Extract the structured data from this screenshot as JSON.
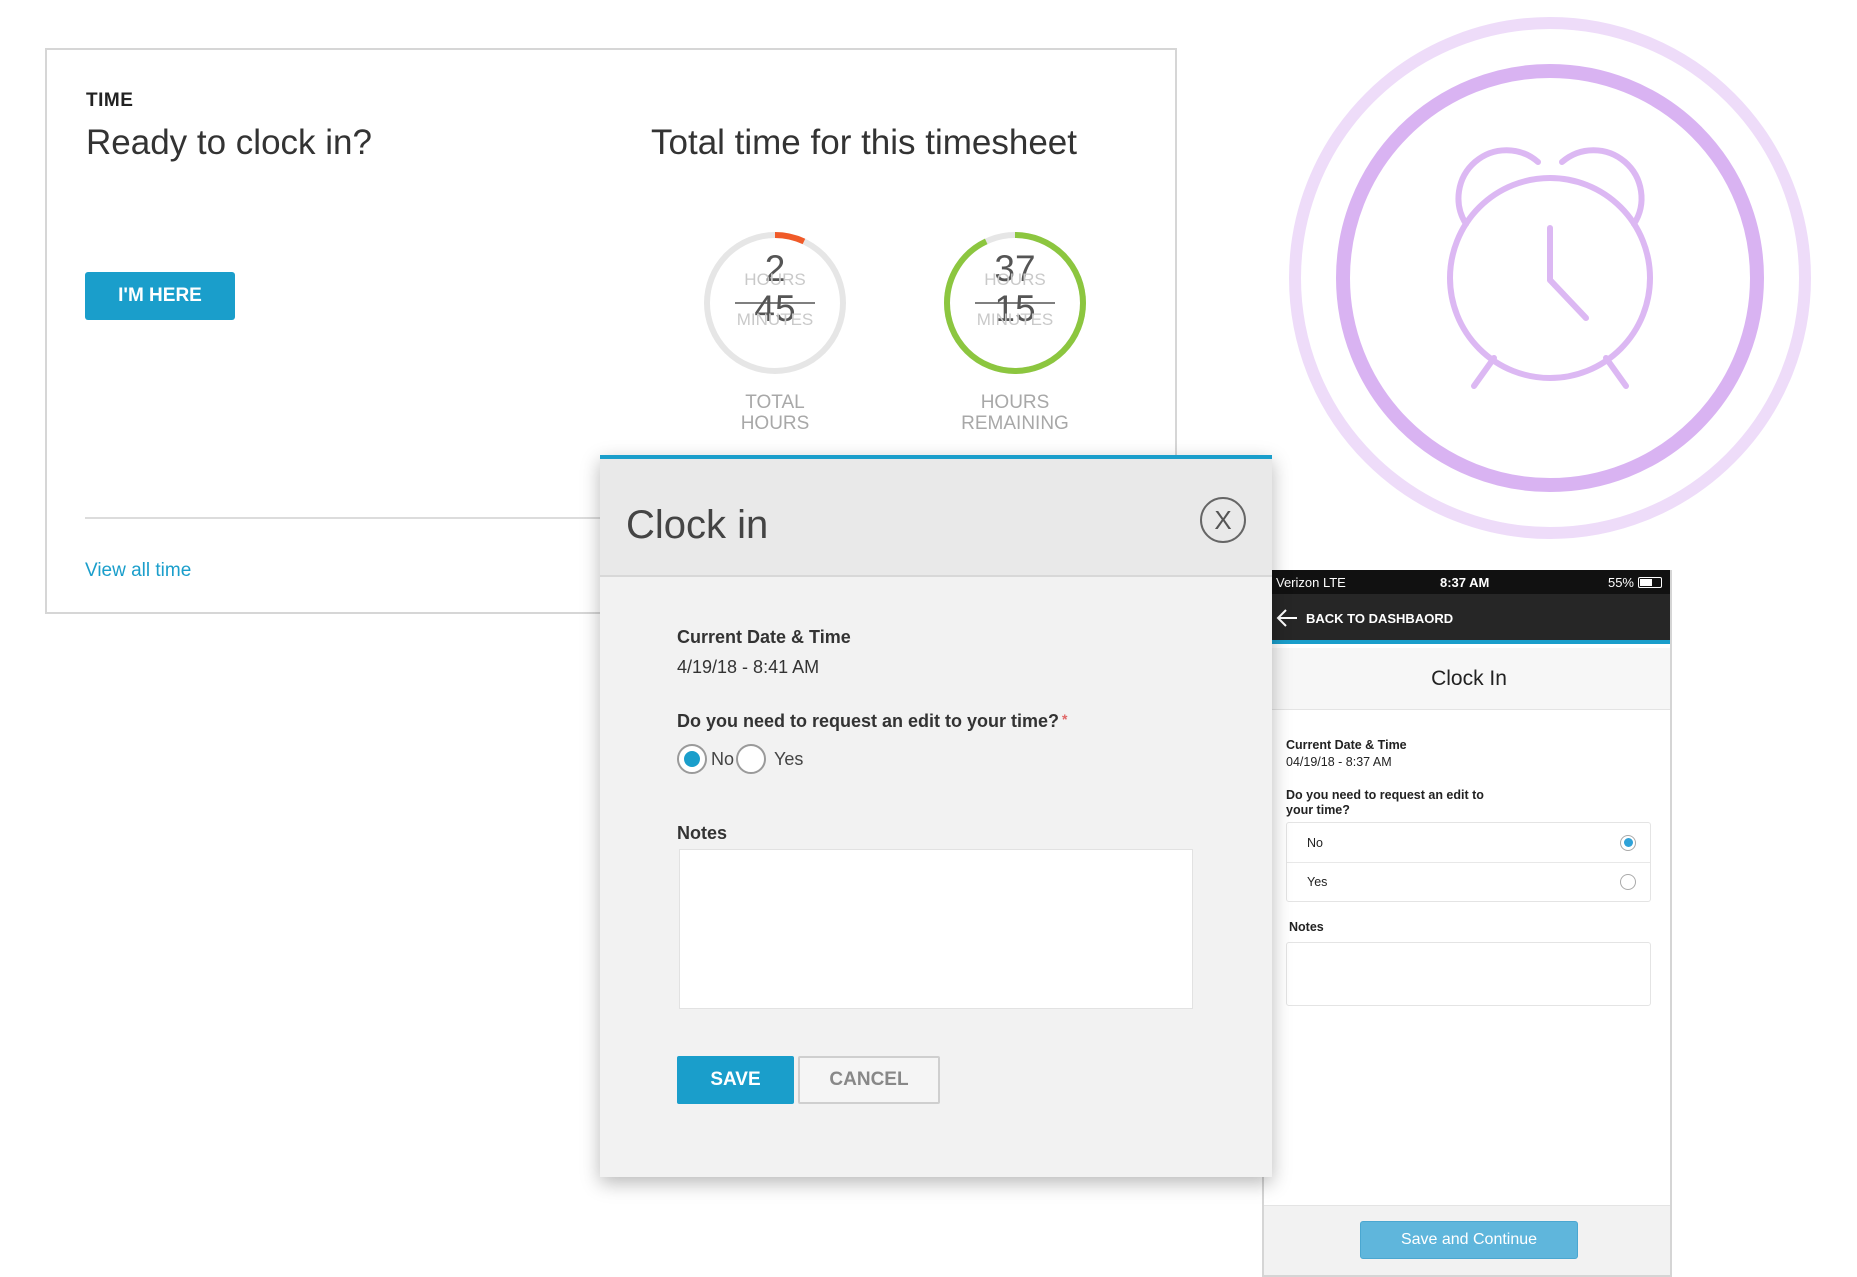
{
  "time_card": {
    "section_label": "TIME",
    "headline": "Ready to clock in?",
    "total_title": "Total time for this timesheet",
    "im_here_label": "I'M HERE",
    "view_all_label": "View all time",
    "total_hours": {
      "hours": "2",
      "hours_unit": "HOURS",
      "minutes": "45",
      "minutes_unit": "MINUTES",
      "caption_line1": "TOTAL",
      "caption_line2": "HOURS",
      "progress": 0.07,
      "color": "#f05a28"
    },
    "hours_remaining": {
      "hours": "37",
      "hours_unit": "HOURS",
      "minutes": "15",
      "minutes_unit": "MINUTES",
      "caption_line1": "HOURS",
      "caption_line2": "REMAINING",
      "progress": 0.93,
      "color": "#8cc63f"
    }
  },
  "illustration": {
    "icon": "alarm-clock-icon",
    "color": "#d4a8f0"
  },
  "modal": {
    "title": "Clock in",
    "close_label": "X",
    "datetime_label": "Current Date & Time",
    "datetime_value": "4/19/18 - 8:41 AM",
    "edit_question": "Do you need to request an edit to your time?",
    "required_marker": "*",
    "options": [
      "No",
      "Yes"
    ],
    "selected_option": "No",
    "notes_label": "Notes",
    "notes_value": "",
    "save_label": "SAVE",
    "cancel_label": "CANCEL"
  },
  "mobile": {
    "carrier": "Verizon  LTE",
    "time": "8:37 AM",
    "battery": "55%",
    "battery_level": 0.55,
    "back_label": "BACK TO DASHBAORD",
    "title": "Clock In",
    "datetime_label": "Current Date & Time",
    "datetime_value": "04/19/18 - 8:37 AM",
    "edit_question_line1": "Do you need to request an edit to",
    "edit_question_line2": "your time?",
    "options": [
      "No",
      "Yes"
    ],
    "selected_option": "No",
    "notes_label": "Notes",
    "save_continue_label": "Save and Continue"
  },
  "colors": {
    "accent": "#1a9ecb",
    "mobile_button": "#5fb6dc"
  }
}
